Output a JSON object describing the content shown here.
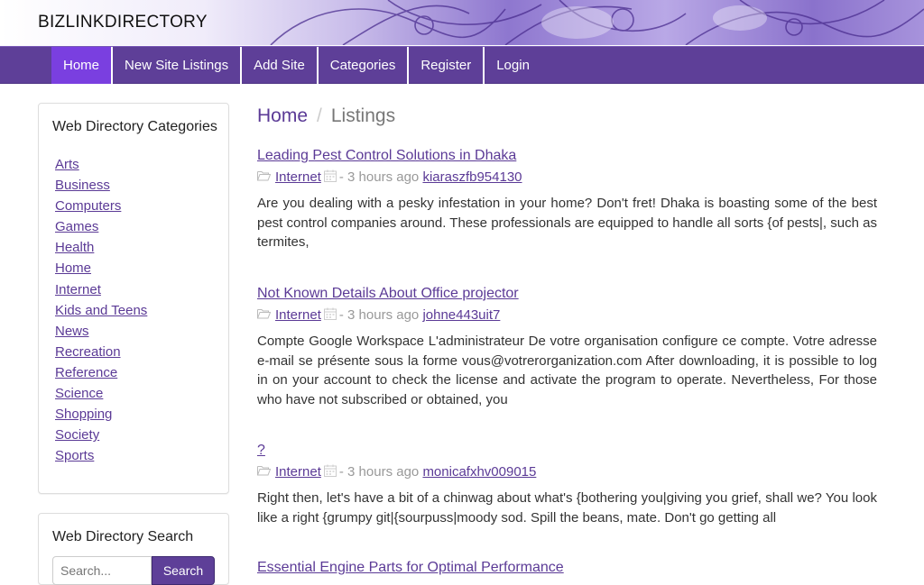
{
  "brand": "BIZLINKDIRECTORY",
  "nav": [
    "Home",
    "New Site Listings",
    "Add Site",
    "Categories",
    "Register",
    "Login"
  ],
  "sidebar": {
    "categories_title": "Web Directory Categories",
    "categories": [
      "Arts",
      "Business",
      "Computers",
      "Games",
      "Health",
      "Home",
      "Internet",
      "Kids and Teens",
      "News",
      "Recreation",
      "Reference",
      "Science",
      "Shopping",
      "Society",
      "Sports"
    ],
    "search_title": "Web Directory Search",
    "search_placeholder": "Search...",
    "search_button": "Search"
  },
  "breadcrumb": {
    "home": "Home",
    "separator": "/",
    "current": "Listings"
  },
  "listings": [
    {
      "title": "Leading Pest Control Solutions in Dhaka",
      "category": "Internet",
      "time": "- 3 hours ago",
      "user": "kiaraszfb954130",
      "description": "Are you dealing with a pesky infestation in your home? Don't fret! Dhaka is boasting some of the best pest control companies around. These professionals are equipped to handle all sorts {of pests|, such as termites,"
    },
    {
      "title": "Not Known Details About Office projector",
      "category": "Internet",
      "time": "- 3 hours ago",
      "user": "johne443uit7",
      "description": "Compte Google Workspace L'administrateur De votre organisation configure ce compte. Votre adresse e-mail se présente sous la forme vous@votrerorganization.com After downloading, it is possible to log in on your account to check the license and activate the program to operate. Nevertheless, For those who have not subscribed or obtained, you"
    },
    {
      "title": "?",
      "category": "Internet",
      "time": "- 3 hours ago",
      "user": "monicafxhv009015",
      "description": "Right then, let's have a bit of a chinwag about what's {bothering you|giving you grief, shall we? You look like a right {grumpy git|{sourpuss|moody sod. Spill the beans, mate. Don't go getting all"
    },
    {
      "title": "Essential Engine Parts for Optimal Performance",
      "category": "",
      "time": "",
      "user": "",
      "description": ""
    }
  ]
}
